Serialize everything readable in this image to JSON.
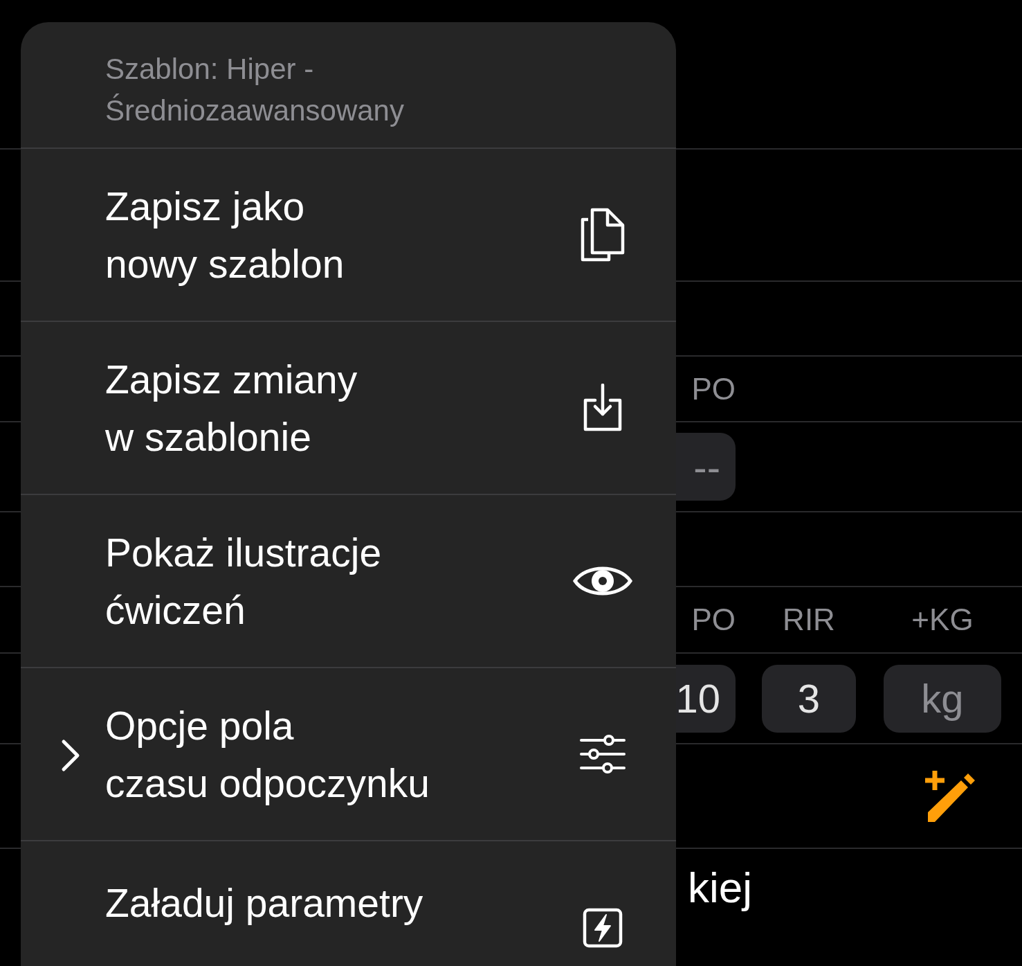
{
  "background": {
    "tempo_label": "PO",
    "tempo_field": "--",
    "columns": [
      "PO",
      "RIR",
      "+KG"
    ],
    "set_fields": [
      {
        "value": "10"
      },
      {
        "value": "3"
      },
      {
        "placeholder": "kg"
      }
    ],
    "exercise_name": "kiej"
  },
  "menu": {
    "header": "Szablon: Hiper - Średniozaawansowany",
    "items": [
      {
        "lines": [
          "Zapisz jako",
          "nowy szablon"
        ],
        "kind": "copy",
        "has_submenu": false
      },
      {
        "lines": [
          "Zapisz zmiany",
          "w szablonie"
        ],
        "kind": "download",
        "has_submenu": false
      },
      {
        "lines": [
          "Pokaż ilustracje",
          "ćwiczeń"
        ],
        "kind": "eye",
        "has_submenu": false
      },
      {
        "lines": [
          "Opcje pola",
          "czasu odpoczynku"
        ],
        "kind": "sliders",
        "has_submenu": true
      },
      {
        "lines": [
          "Załaduj parametry"
        ],
        "kind": "bolt",
        "has_submenu": false
      }
    ]
  }
}
